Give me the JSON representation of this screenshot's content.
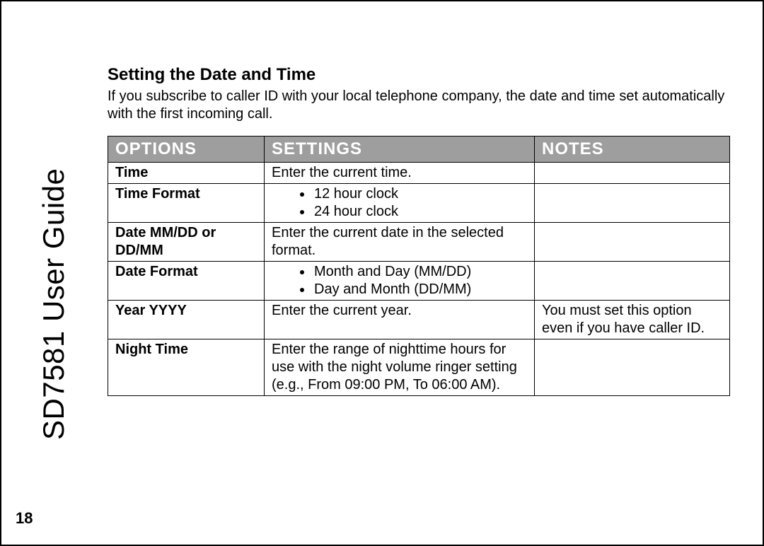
{
  "sideline": "SD7581 User Guide",
  "section": {
    "title": "Setting the Date and Time",
    "desc": "If you subscribe to caller ID with your local telephone company, the date and time set automatically with the first incoming call."
  },
  "table": {
    "headers": {
      "options": "OPTIONS",
      "settings": "SETTINGS",
      "notes": "NOTES"
    },
    "rows": [
      {
        "option": "Time",
        "settings_text": "Enter the current time.",
        "notes": ""
      },
      {
        "option": "Time Format",
        "settings_list": [
          "12  hour clock",
          "24 hour clock"
        ],
        "notes": ""
      },
      {
        "option": "Date MM/DD or DD/MM",
        "settings_text": "Enter the current date in the selected format.",
        "notes": ""
      },
      {
        "option": "Date Format",
        "settings_list": [
          "Month and Day (MM/DD)",
          "Day and Month (DD/MM)"
        ],
        "notes": ""
      },
      {
        "option": "Year YYYY",
        "settings_text": "Enter the current year.",
        "notes": "You must set this option even if you have caller ID."
      },
      {
        "option": "Night Time",
        "settings_text": "Enter the range of nighttime hours for use with the night volume ringer setting (e.g., From 09:00 PM, To 06:00 AM).",
        "notes": ""
      }
    ]
  },
  "page_number": "18"
}
